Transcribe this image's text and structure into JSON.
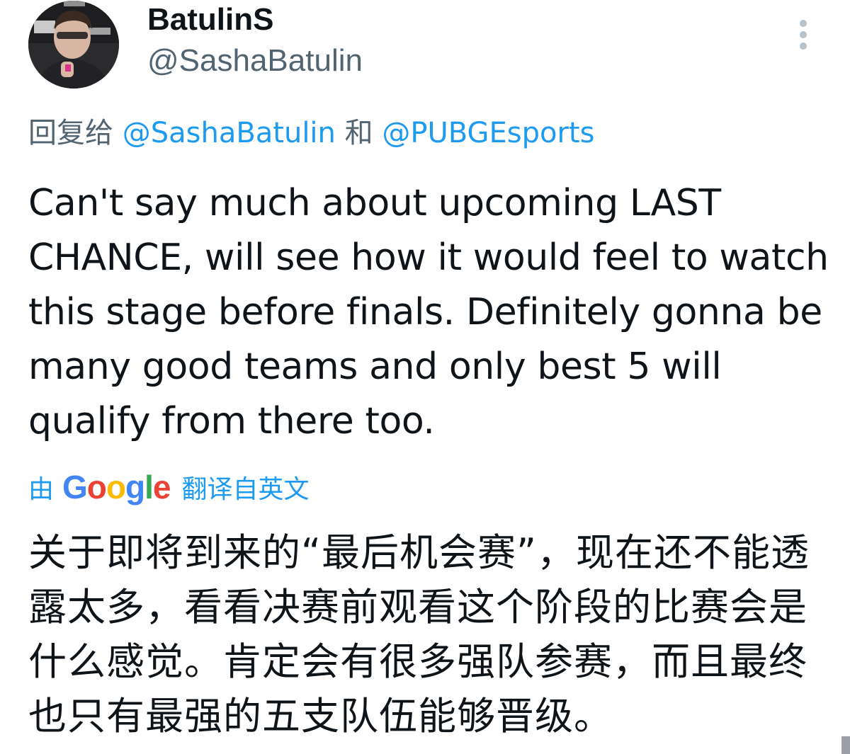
{
  "author": {
    "display_name": "BatulinS",
    "handle": "@SashaBatulin",
    "avatar_icon": "user-avatar-photo"
  },
  "reply": {
    "prefix": "回复给",
    "mentions": [
      "@SashaBatulin",
      "@PUBGEsports"
    ],
    "joiner": "和"
  },
  "tweet": {
    "text": "Can't say much about upcoming LAST CHANCE, will see how it would feel to watch this stage before finals. Definitely gonna be many good teams and only best 5 will qualify from there too."
  },
  "translation": {
    "by_label": "由",
    "provider": "Google",
    "suffix_label": "翻译自英文",
    "text": "关于即将到来的“最后机会赛”，现在还不能透露太多，看看决赛前观看这个阶段的比赛会是什么感觉。肯定会有很多强队参赛，而且最终也只有最强的五支队伍能够晋级。"
  },
  "colors": {
    "link": "#1d9bf0",
    "secondary_text": "#536471",
    "primary_text": "#0f1419",
    "google_blue": "#4285f4",
    "google_red": "#ea4335",
    "google_yellow": "#fbbc05",
    "google_green": "#34a853"
  },
  "icons": {
    "more": "vertical-ellipsis-icon"
  }
}
